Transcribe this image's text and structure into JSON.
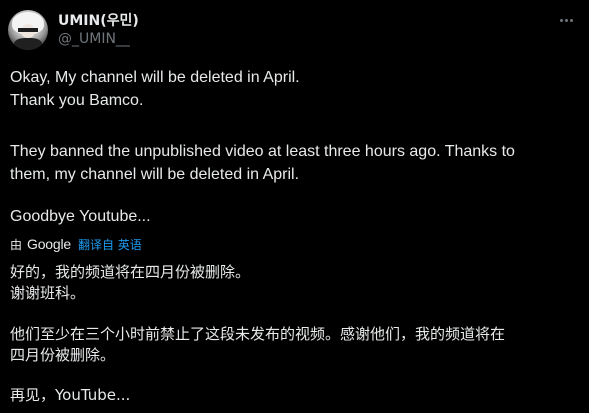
{
  "author": {
    "display_name": "UMIN(우민)",
    "handle": "@_UMIN__"
  },
  "tweet": {
    "line1": "Okay, My channel will be deleted in April.",
    "line2": "Thank you Bamco.",
    "para2_line1": "They banned the unpublished video at least three hours ago. Thanks to",
    "para2_line2": "them, my channel will be deleted in April.",
    "line_last": "Goodbye Youtube..."
  },
  "translation": {
    "by_label": "由",
    "provider": "Google",
    "from_label": "翻译自 英语",
    "line1": "好的，我的频道将在四月份被删除。",
    "line2": "谢谢班科。",
    "para2_line1": "他们至少在三个小时前禁止了这段未发布的视频。感谢他们，我的频道将在",
    "para2_line2": "四月份被删除。",
    "line_last": "再见，YouTube..."
  },
  "colors": {
    "background": "#000000",
    "text": "#e7e9ea",
    "secondary": "#71767b",
    "accent": "#1d9bf0"
  },
  "icons": {
    "more": "more-horizontal-icon"
  }
}
